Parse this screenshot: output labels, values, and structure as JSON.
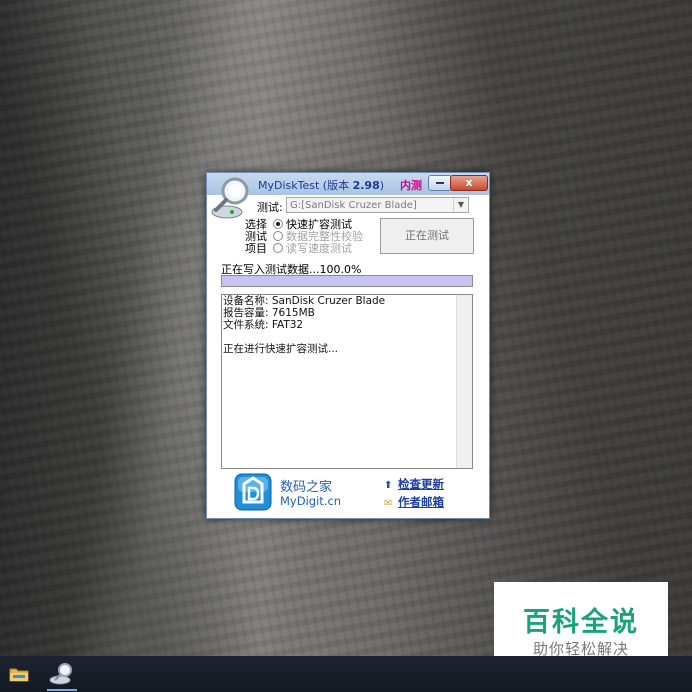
{
  "window": {
    "title_name": "MyDiskTest (版本 ",
    "title_version": "2.98",
    "title_close_paren": ")",
    "title_badge": "内测",
    "close_glyph": "x"
  },
  "test": {
    "label": "测试:",
    "drive_value": "G:[SanDisk Cruzer Blade]",
    "dropdown_glyph": "▼"
  },
  "options": {
    "side_label": "选择测试项目",
    "items": [
      {
        "label": "快速扩容测试",
        "selected": true,
        "enabled": true
      },
      {
        "label": "数据完整性校验",
        "selected": false,
        "enabled": false
      },
      {
        "label": "读写速度测试",
        "selected": false,
        "enabled": false
      }
    ]
  },
  "start_button": "正在测试",
  "status": {
    "text": "正在写入测试数据...100.0%",
    "progress": 1.0
  },
  "log": {
    "lines": "设备名称: SanDisk Cruzer Blade\n报告容量: 7615MB\n文件系统: FAT32\n\n正在进行快速扩容测试..."
  },
  "footer": {
    "site_name": "数码之家",
    "site_url": "MyDigit.cn",
    "check_update": "检查更新",
    "author_email": "作者邮箱"
  },
  "watermark": {
    "title": "百科全说",
    "subtitle": "助你轻松解决"
  },
  "colors": {
    "title_text": "#1f3a93",
    "badge": "#d8008a",
    "progress_fill": "#c8c3f2",
    "link": "#1f3fa5",
    "watermark_green": "#1aa37a"
  },
  "icons": {
    "app": "magnifier-disk-icon",
    "site": "mydigit-logo-icon",
    "update": "up-arrow-icon",
    "email": "envelope-icon",
    "explorer": "folder-icon",
    "taskbar_app": "disk-test-app-icon"
  }
}
